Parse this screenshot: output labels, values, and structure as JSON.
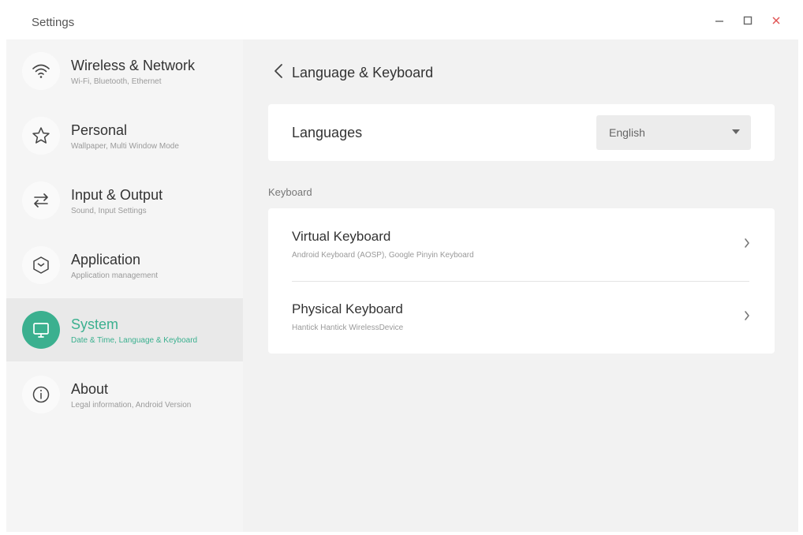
{
  "window": {
    "title": "Settings",
    "controls": [
      "minimize-icon",
      "maximize-icon",
      "close-icon"
    ],
    "close_color": "#e05555"
  },
  "sidebar": {
    "active_color": "#3bb08f",
    "items": [
      {
        "label": "Wireless & Network",
        "sub": "Wi-Fi, Bluetooth, Ethernet",
        "icon": "wifi-icon"
      },
      {
        "label": "Personal",
        "sub": "Wallpaper, Multi Window Mode",
        "icon": "star-icon"
      },
      {
        "label": "Input & Output",
        "sub": "Sound, Input Settings",
        "icon": "arrows-icon"
      },
      {
        "label": "Application",
        "sub": "Application management",
        "icon": "app-icon"
      },
      {
        "label": "System",
        "sub": "Date & Time, Language & Keyboard",
        "icon": "monitor-icon",
        "active": true
      },
      {
        "label": "About",
        "sub": "Legal information, Android Version",
        "icon": "info-icon"
      }
    ]
  },
  "main": {
    "title": "Language & Keyboard",
    "languages": {
      "label": "Languages",
      "selected": "English"
    },
    "keyboard_section": "Keyboard",
    "keyboards": [
      {
        "title": "Virtual Keyboard",
        "sub": "Android Keyboard (AOSP), Google Pinyin Keyboard"
      },
      {
        "title": "Physical Keyboard",
        "sub": "Hantick Hantick WirelessDevice"
      }
    ]
  }
}
